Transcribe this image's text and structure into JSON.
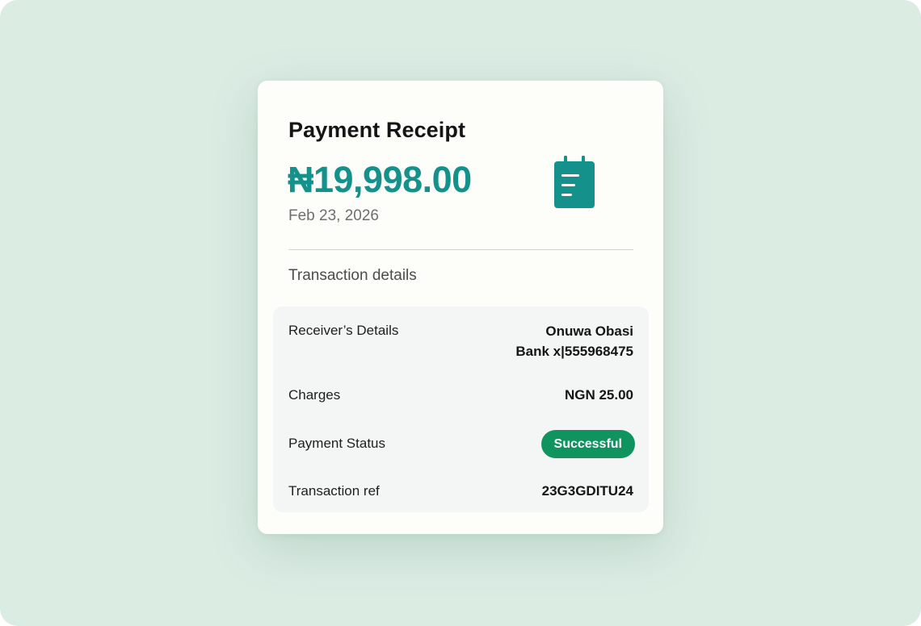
{
  "receipt": {
    "title": "Payment Receipt",
    "amount": "₦19,998.00",
    "date": "Feb 23, 2026",
    "section_title": "Transaction details",
    "accent_color": "#14918b"
  },
  "details": {
    "receiver": {
      "label": "Receiver’s Details",
      "name": "Onuwa Obasi",
      "account": "Bank x|555968475"
    },
    "charges": {
      "label": "Charges",
      "value": "NGN 25.00"
    },
    "status": {
      "label": "Payment Status",
      "value": "Successful",
      "badge_color": "#0f935f"
    },
    "reference": {
      "label": "Transaction ref",
      "value": "23G3GDITU24"
    }
  },
  "icons": {
    "receipt": "receipt-icon"
  }
}
